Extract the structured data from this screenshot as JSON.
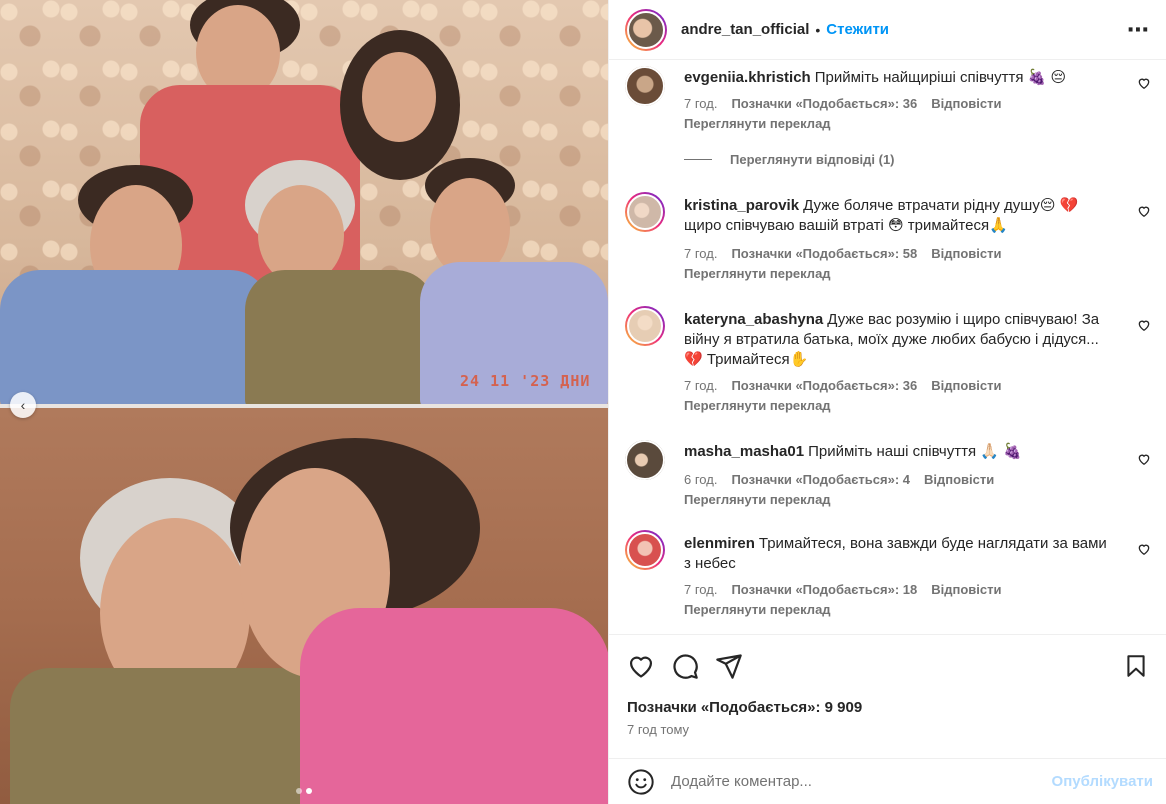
{
  "post": {
    "username": "andre_tan_official",
    "separator": "•",
    "follow_label": "Стежити",
    "more_label": "•••",
    "photo_stamp": "24 11 '23 ДНИ"
  },
  "comments": [
    {
      "username": "evgeniia.khristich",
      "text": "Прийміть найщиріші співчуття 🍇 😔",
      "time": "7 год.",
      "likes": "Позначки «Подобається»: 36",
      "reply": "Відповісти",
      "translate": "Переглянути переклад",
      "avatar_color": "#8a6a4f"
    },
    {
      "username": "kristina_parovik",
      "text": "Дуже боляче втрачати рідну душу😔 💔 щиро співчуваю вашій втраті 😳 тримайтеся🙏",
      "time": "7 год.",
      "likes": "Позначки «Подобається»: 58",
      "reply": "Відповісти",
      "translate": "Переглянути переклад",
      "avatar_color": "#cfb8a8"
    },
    {
      "username": "kateryna_abashyna",
      "text": "Дуже вас розумію і щиро співчуваю! За війну я втратила батька, моїх дуже любих бабусю і дідуся... 💔 Тримайтеся✋",
      "time": "7 год.",
      "likes": "Позначки «Подобається»: 36",
      "reply": "Відповісти",
      "translate": "Переглянути переклад",
      "avatar_color": "#e6cdb4"
    },
    {
      "username": "masha_masha01",
      "text": "Прийміть наші співчуття 🙏🏻 🍇",
      "time": "6 год.",
      "likes": "Позначки «Подобається»: 4",
      "reply": "Відповісти",
      "translate": "Переглянути переклад",
      "avatar_color": "#5a4a3c"
    },
    {
      "username": "elenmiren",
      "text": "Тримайтеся, вона завжди буде наглядати за вами з небес",
      "time": "7 год.",
      "likes": "Позначки «Подобається»: 18",
      "reply": "Відповісти",
      "translate": "Переглянути переклад",
      "avatar_color": "#d8514f"
    }
  ],
  "view_replies": "Переглянути відповіді (1)",
  "actions": {
    "likes_total": "Позначки «Подобається»: 9 909",
    "posted_time": "7 год тому"
  },
  "add_comment": {
    "placeholder": "Додайте коментар...",
    "publish_label": "Опублікувати"
  },
  "colors": {
    "accent": "#0095f6",
    "muted": "#737373",
    "publish_disabled": "#b3dbff"
  }
}
